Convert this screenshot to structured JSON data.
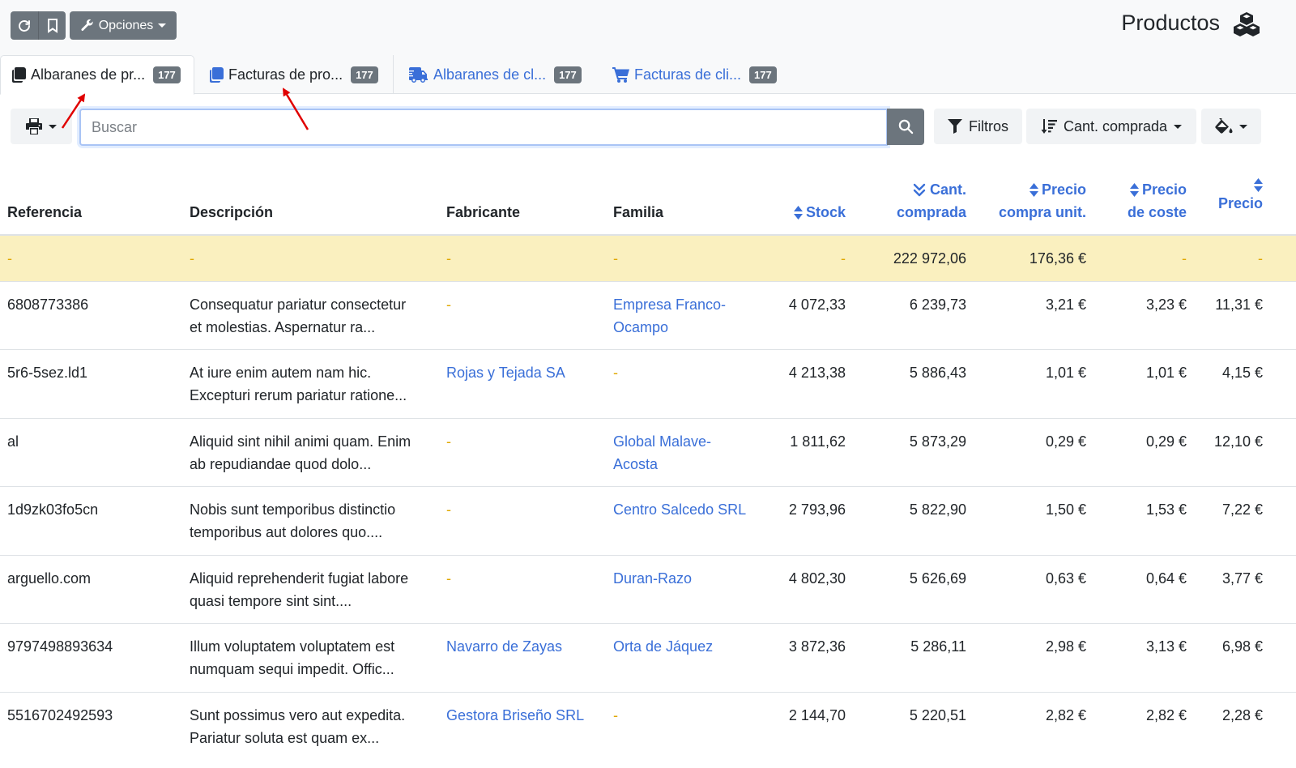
{
  "topbar": {
    "refresh_icon": "refresh-icon",
    "bookmark_icon": "bookmark-icon",
    "options_label": "Opciones",
    "page_title": "Productos",
    "title_icon": "cubes-icon"
  },
  "tabs": [
    {
      "label": "Albaranes de pr...",
      "count": "177",
      "icon": "copy-icon",
      "active": true
    },
    {
      "label": "Facturas de pro...",
      "count": "177",
      "icon": "copy-icon",
      "active": false
    },
    {
      "label": "Albaranes de cl...",
      "count": "177",
      "icon": "truck-icon",
      "active": false
    },
    {
      "label": "Facturas de cli...",
      "count": "177",
      "icon": "cart-icon",
      "active": false
    }
  ],
  "toolbar": {
    "search_placeholder": "Buscar",
    "search_value": "",
    "filters_label": "Filtros",
    "sort_label": "Cant. comprada"
  },
  "colors": {
    "accent": "#3a6fd8",
    "secondary": "#6c757d",
    "totals_bg": "#faf0bf",
    "empty_dash": "#e0a800"
  },
  "table": {
    "headers": {
      "referencia": "Referencia",
      "descripcion": "Descripción",
      "fabricante": "Fabricante",
      "familia": "Familia",
      "stock": "Stock",
      "cant1": "Cant.",
      "cant2": "comprada",
      "pcu1": "Precio",
      "pcu2": "compra unit.",
      "pc1": "Precio",
      "pc2": "de coste",
      "precio": "Precio"
    },
    "totals": {
      "referencia": "-",
      "descripcion": "-",
      "fabricante": "-",
      "familia": "-",
      "stock": "-",
      "cant": "222 972,06",
      "pcu": "176,36 €",
      "pc": "-",
      "precio": "-"
    },
    "rows": [
      {
        "referencia": "6808773386",
        "desc1": "Consequatur pariatur consectetur",
        "desc2": "et molestias. Aspernatur ra...",
        "fabricante": "-",
        "familia1": "Empresa Franco-",
        "familia2": "Ocampo",
        "stock": "4 072,33",
        "cant": "6 239,73",
        "pcu": "3,21 €",
        "pc": "3,23 €",
        "precio": "11,31 €"
      },
      {
        "referencia": "5r6-5sez.ld1",
        "desc1": "At iure enim autem nam hic.",
        "desc2": "Excepturi rerum pariatur ratione...",
        "fabricante": "Rojas y Tejada SA",
        "familia1": "-",
        "familia2": "",
        "stock": "4 213,38",
        "cant": "5 886,43",
        "pcu": "1,01 €",
        "pc": "1,01 €",
        "precio": "4,15 €"
      },
      {
        "referencia": "al",
        "desc1": "Aliquid sint nihil animi quam. Enim",
        "desc2": "ab repudiandae quod dolo...",
        "fabricante": "-",
        "familia1": "Global Malave-",
        "familia2": "Acosta",
        "stock": "1 811,62",
        "cant": "5 873,29",
        "pcu": "0,29 €",
        "pc": "0,29 €",
        "precio": "12,10 €"
      },
      {
        "referencia": "1d9zk03fo5cn",
        "desc1": "Nobis sunt temporibus distinctio",
        "desc2": "temporibus aut dolores quo....",
        "fabricante": "-",
        "familia1": "Centro Salcedo SRL",
        "familia2": "",
        "stock": "2 793,96",
        "cant": "5 822,90",
        "pcu": "1,50 €",
        "pc": "1,53 €",
        "precio": "7,22 €"
      },
      {
        "referencia": "arguello.com",
        "desc1": "Aliquid reprehenderit fugiat labore",
        "desc2": "quasi tempore sint sint....",
        "fabricante": "-",
        "familia1": "Duran-Razo",
        "familia2": "",
        "stock": "4 802,30",
        "cant": "5 626,69",
        "pcu": "0,63 €",
        "pc": "0,64 €",
        "precio": "3,77 €"
      },
      {
        "referencia": "9797498893634",
        "desc1": "Illum voluptatem voluptatem est",
        "desc2": "numquam sequi impedit. Offic...",
        "fabricante": "Navarro de Zayas",
        "familia1": "Orta de Jáquez",
        "familia2": "",
        "stock": "3 872,36",
        "cant": "5 286,11",
        "pcu": "2,98 €",
        "pc": "3,13 €",
        "precio": "6,98 €"
      },
      {
        "referencia": "5516702492593",
        "desc1": "Sunt possimus vero aut expedita.",
        "desc2": "Pariatur soluta est quam ex...",
        "fabricante": "Gestora Briseño SRL",
        "familia1": "-",
        "familia2": "",
        "stock": "2 144,70",
        "cant": "5 220,51",
        "pcu": "2,82 €",
        "pc": "2,82 €",
        "precio": "2,28 €"
      }
    ]
  }
}
